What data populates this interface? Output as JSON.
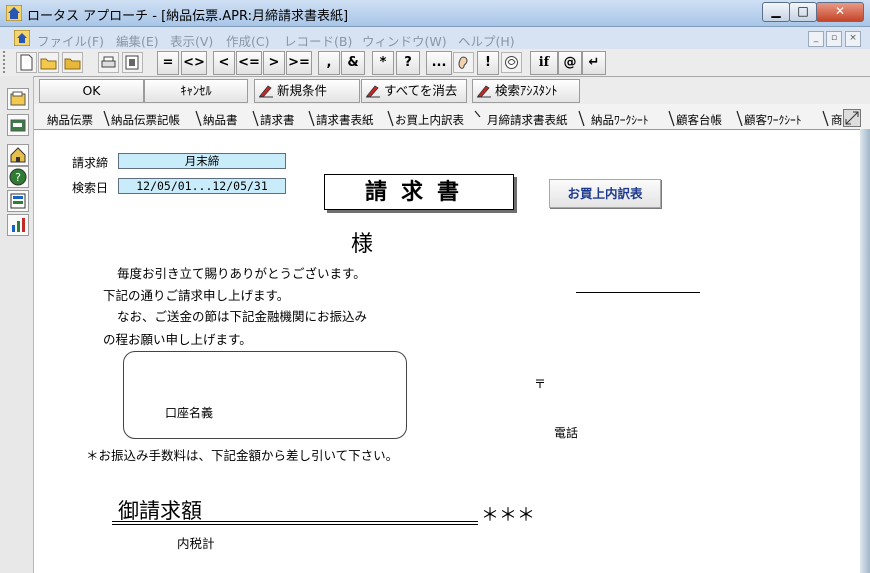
{
  "window": {
    "title": "ロータス アプローチ - [納品伝票.APR:月締請求書表紙]",
    "minimize": "▁",
    "maximize": "□",
    "close": "✕"
  },
  "menu": {
    "items": [
      "ファイル(F)",
      "編集(E)",
      "表示(V)",
      "作成(C)",
      "レコード(B)",
      "ウィンドウ(W)",
      "ヘルプ(H)"
    ],
    "mdi": [
      "_",
      "▫",
      "×"
    ]
  },
  "toolbar": {
    "ops": [
      "=",
      "<>",
      "<",
      "<=",
      ">",
      ">=",
      ",",
      "&",
      "*",
      "?",
      "...",
      "!",
      "if",
      "@",
      "↵"
    ]
  },
  "actions": {
    "ok": "OK",
    "cancel": "ｷｬﾝｾﾙ",
    "new_condition": "新規条件",
    "clear_all": "すべてを消去",
    "search_assistant": "検索ｱｼｽﾀﾝﾄ"
  },
  "tabs": [
    "納品伝票",
    "納品伝票記帳",
    "納品書",
    "請求書",
    "請求書表紙",
    "お買上内訳表",
    "月締請求書表紙",
    "納品ﾜｰｸｼｰﾄ",
    "顧客台帳",
    "顧客ﾜｰｸｼｰﾄ",
    "商"
  ],
  "form": {
    "billing_cutoff_label": "請求締",
    "billing_cutoff_value": "月末締",
    "search_date_label": "検索日",
    "search_date_value": "12/05/01...12/05/31",
    "doc_title": "請求書",
    "purchase_breakdown_button": "お買上内訳表",
    "honorific": "様",
    "greeting_lines": [
      "毎度お引き立て賜りありがとうございます。",
      "下記の通りご請求申し上げます。",
      "なお、ご送金の節は下記金融機関にお振込み",
      "の程お願い申し上げます。"
    ],
    "account_holder_label": "口座名義",
    "postal_mark": "〒",
    "phone_label": "電話",
    "fee_note": "＊お振込み手数料は、下記金額から差し引いて下さい。",
    "amount_label": "御請求額",
    "amount_value": "＊＊＊",
    "tax_included_label": "内税計"
  }
}
